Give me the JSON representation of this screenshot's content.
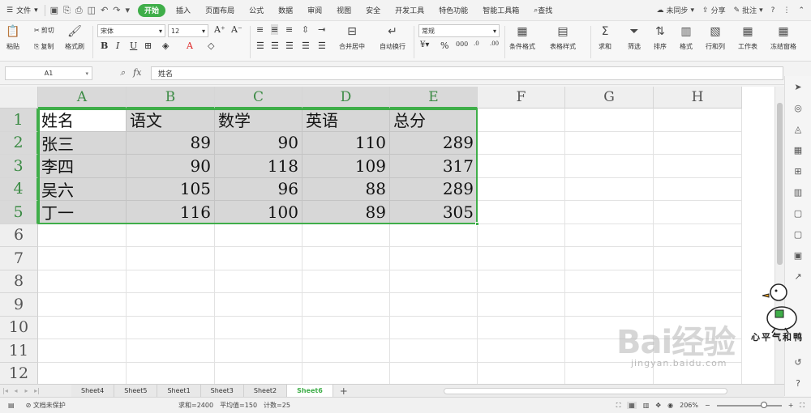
{
  "menubar": {
    "file_label": "文件",
    "tabs": [
      "开始",
      "插入",
      "页面布局",
      "公式",
      "数据",
      "审阅",
      "视图",
      "安全",
      "开发工具",
      "特色功能",
      "智能工具箱"
    ],
    "search_label": "查找",
    "right": {
      "sync": "未同步",
      "share": "分享",
      "comment": "批注"
    }
  },
  "ribbon": {
    "paste": "粘贴",
    "cut": "剪切",
    "copy": "复制",
    "format_painter": "格式刷",
    "font_name": "宋体",
    "font_size": "12",
    "merge_center": "合并居中",
    "wrap_text": "自动换行",
    "number_format": "常规",
    "conditional_format": "条件格式",
    "table_style": "表格样式",
    "sum": "求和",
    "filter": "筛选",
    "sort": "排序",
    "format": "格式",
    "row_col": "行和列",
    "worksheet": "工作表",
    "freeze": "冻结窗格"
  },
  "formula_bar": {
    "cell_ref": "A1",
    "fx": "fx",
    "content": "姓名"
  },
  "columns": [
    "A",
    "B",
    "C",
    "D",
    "E",
    "F",
    "G",
    "H"
  ],
  "rows": [
    "1",
    "2",
    "3",
    "4",
    "5",
    "6",
    "7",
    "8",
    "9",
    "10",
    "11",
    "12"
  ],
  "table": {
    "header": [
      "姓名",
      "语文",
      "数学",
      "英语",
      "总分"
    ],
    "body": [
      [
        "张三",
        "89",
        "90",
        "110",
        "289"
      ],
      [
        "李四",
        "90",
        "118",
        "109",
        "317"
      ],
      [
        "吴六",
        "105",
        "96",
        "88",
        "289"
      ],
      [
        "丁一",
        "116",
        "100",
        "89",
        "305"
      ]
    ]
  },
  "sheets": [
    "Sheet4",
    "Sheet5",
    "Sheet1",
    "Sheet3",
    "Sheet2",
    "Sheet6"
  ],
  "active_sheet": "Sheet6",
  "status": {
    "protect": "文档未保护",
    "sum": "求和=2400",
    "avg": "平均值=150",
    "count": "计数=25",
    "zoom": "206%"
  },
  "watermark": {
    "baidu": "Bai经验",
    "url": "jingyan.baidu.com",
    "caption": "心平气和鸭"
  },
  "colors": {
    "accent": "#3fae49",
    "selection": "#d7d7d7"
  }
}
